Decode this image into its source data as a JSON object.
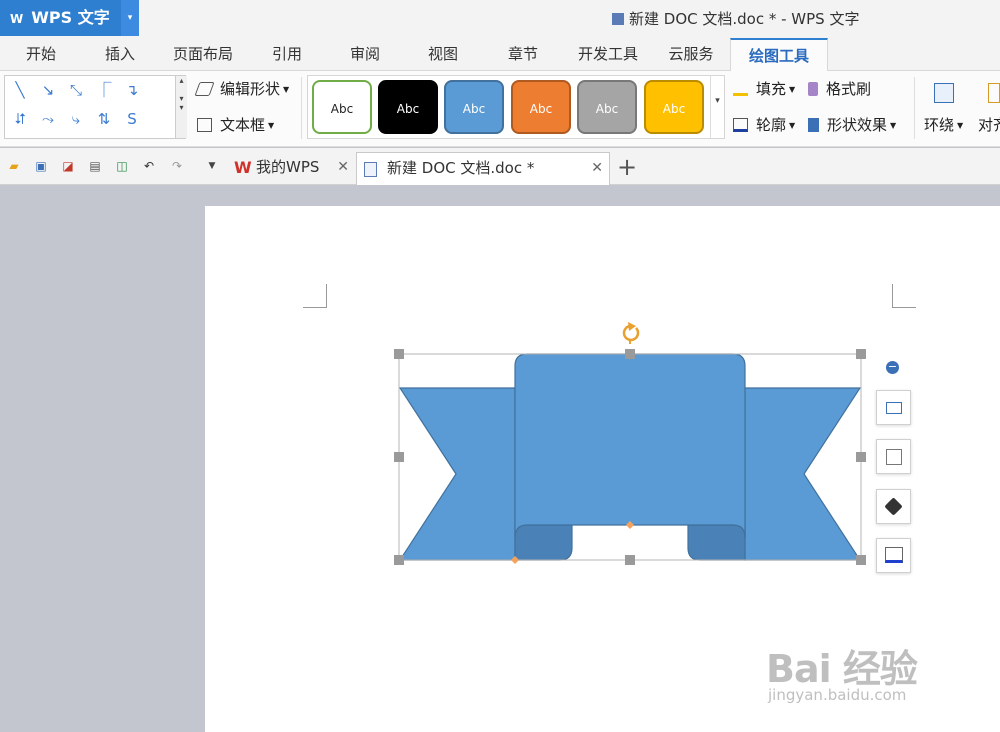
{
  "app": {
    "logo_glyph": "W",
    "name": "WPS 文字",
    "dropdown_glyph": "▾"
  },
  "window": {
    "title": "新建 DOC 文档.doc * - WPS 文字"
  },
  "menu": {
    "tabs": [
      {
        "label": "开始"
      },
      {
        "label": "插入"
      },
      {
        "label": "页面布局"
      },
      {
        "label": "引用"
      },
      {
        "label": "审阅"
      },
      {
        "label": "视图"
      },
      {
        "label": "章节"
      },
      {
        "label": "开发工具"
      },
      {
        "label": "云服务"
      },
      {
        "label": "绘图工具"
      }
    ],
    "active": "绘图工具"
  },
  "ribbon": {
    "edit_shape": "编辑形状",
    "text_box": "文本框",
    "fill": "填充",
    "format_painter": "格式刷",
    "outline": "轮廓",
    "shape_effects": "形状效果",
    "wrap": "环绕",
    "align": "对齐",
    "style_swatches": [
      {
        "label": "Abc",
        "bg": "#ffffff",
        "border": "#70ad47",
        "color": "#222222"
      },
      {
        "label": "Abc",
        "bg": "#000000",
        "border": "#000000",
        "color": "#ffffff"
      },
      {
        "label": "Abc",
        "bg": "#5b9bd5",
        "border": "#41719c",
        "color": "#ffffff"
      },
      {
        "label": "Abc",
        "bg": "#ed7d31",
        "border": "#ae5a21",
        "color": "#ffffff"
      },
      {
        "label": "Abc",
        "bg": "#a5a5a5",
        "border": "#787878",
        "color": "#ffffff"
      },
      {
        "label": "Abc",
        "bg": "#ffc000",
        "border": "#bc8c00",
        "color": "#ffffff"
      }
    ]
  },
  "doc_tabs": [
    {
      "label": "我的WPS",
      "close": "✕"
    },
    {
      "label": "新建 DOC 文档.doc *",
      "close": "✕"
    }
  ],
  "new_tab_glyph": "+",
  "shape": {
    "fill": "#5b9bd5",
    "stroke": "#41719c",
    "fold_fill": "#4a82b8"
  },
  "side_tools": [
    "layout-options",
    "edit-shape",
    "fill",
    "outline"
  ],
  "watermark": {
    "logo": "Bai 经验",
    "url": "jingyan.baidu.com"
  }
}
